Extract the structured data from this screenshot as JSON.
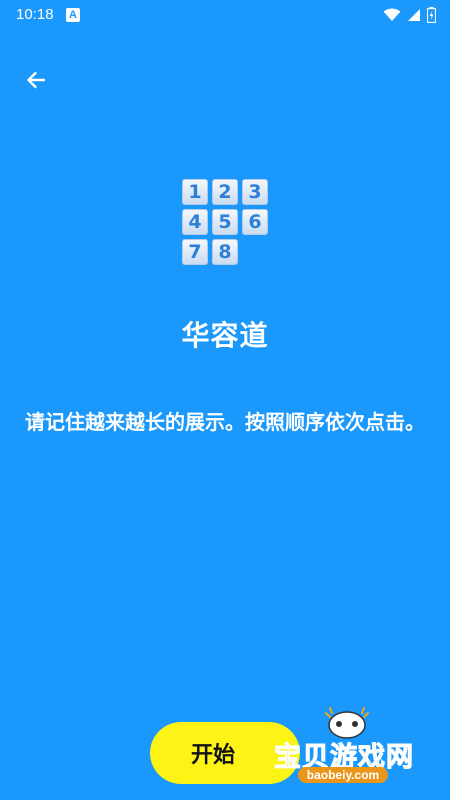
{
  "status_bar": {
    "time": "10:18",
    "app_icon_letter": "A",
    "icons": [
      "wifi-icon",
      "signal-icon",
      "battery-icon"
    ]
  },
  "header": {
    "back_icon": "arrow-left-icon"
  },
  "logo": {
    "tiles": [
      "1",
      "2",
      "3",
      "4",
      "5",
      "6",
      "7",
      "8"
    ]
  },
  "title": "华容道",
  "instructions": "请记住越来越长的展示。按照顺序依次点击。",
  "start_button": {
    "label": "开始"
  },
  "watermark": {
    "text": "宝贝游戏网",
    "url": "baobeiy.com"
  },
  "colors": {
    "background": "#1a98fc",
    "button": "#fcf414",
    "tile_text": "#2f7fd6",
    "watermark": "#f4a516"
  }
}
